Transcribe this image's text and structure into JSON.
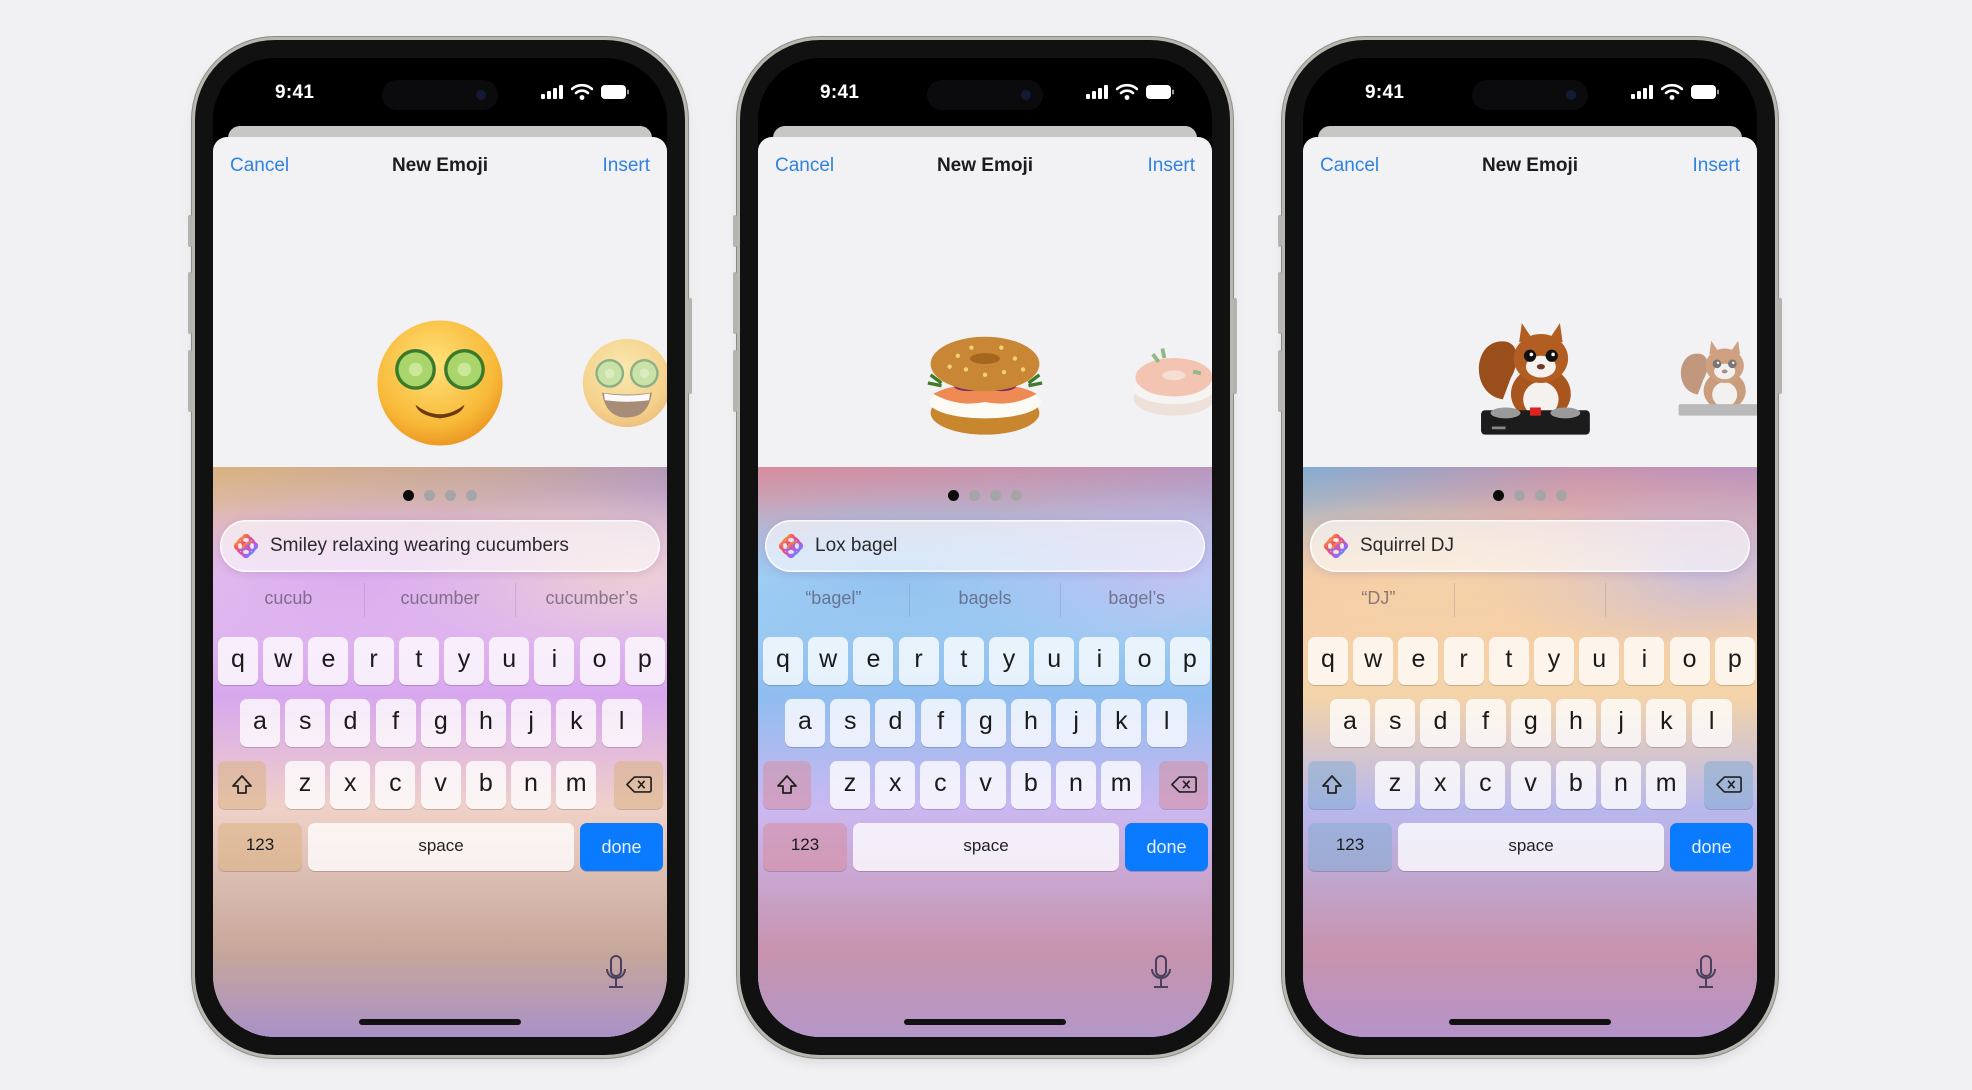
{
  "background": "#f1f1f3",
  "accent": "#2f82e0",
  "done_color": "#0a7aff",
  "phones": [
    {
      "status": {
        "time": "9:41",
        "icons": [
          "cellular-signal-icon",
          "wifi-icon",
          "battery-icon"
        ]
      },
      "nav": {
        "cancel": "Cancel",
        "title": "New Emoji",
        "insert": "Insert"
      },
      "carousel": {
        "main_image": "cucumber-face-emoji",
        "next_image": "grinning-cucumber-face-emoji",
        "pages": 4,
        "active_page": 1
      },
      "search": {
        "icon": "apple-intelligence-icon",
        "query": "Smiley relaxing wearing cucumbers"
      },
      "suggestions": [
        "cucub",
        "cucumber",
        "cucumber’s"
      ],
      "theme": {
        "glow": [
          "#e8c6ef",
          "#d7a7ee",
          "#efd1c8"
        ],
        "bottom": [
          "#d9b27f",
          "#c7a79a",
          "#a991c7"
        ]
      }
    },
    {
      "status": {
        "time": "9:41",
        "icons": [
          "cellular-signal-icon",
          "wifi-icon",
          "battery-icon"
        ]
      },
      "nav": {
        "cancel": "Cancel",
        "title": "New Emoji",
        "insert": "Insert"
      },
      "carousel": {
        "main_image": "lox-bagel-emoji",
        "next_image": "salmon-bagel-emoji",
        "pages": 4,
        "active_page": 1
      },
      "search": {
        "icon": "apple-intelligence-icon",
        "query": "Lox bagel"
      },
      "suggestions": [
        "“bagel”",
        "bagels",
        "bagel’s"
      ],
      "theme": {
        "glow": [
          "#a8d8f4",
          "#8fbdf0",
          "#cbb8f1"
        ],
        "bottom": [
          "#d78d9e",
          "#c793ad",
          "#b497c8"
        ]
      }
    },
    {
      "status": {
        "time": "9:41",
        "icons": [
          "cellular-signal-icon",
          "wifi-icon",
          "battery-icon"
        ]
      },
      "nav": {
        "cancel": "Cancel",
        "title": "New Emoji",
        "insert": "Insert"
      },
      "carousel": {
        "main_image": "squirrel-dj-emoji",
        "next_image": "squirrel-turntable-emoji",
        "pages": 4,
        "active_page": 1
      },
      "search": {
        "icon": "apple-intelligence-icon",
        "query": "Squirrel DJ"
      },
      "suggestions": [
        "“DJ”",
        "",
        ""
      ],
      "theme": {
        "glow": [
          "#f6c9a6",
          "#f4d4a8",
          "#b8b8ee"
        ],
        "bottom": [
          "#84acd2",
          "#c893ad",
          "#b593c9"
        ]
      }
    }
  ],
  "keyboard": {
    "row1": [
      "q",
      "w",
      "e",
      "r",
      "t",
      "y",
      "u",
      "i",
      "o",
      "p"
    ],
    "row2": [
      "a",
      "s",
      "d",
      "f",
      "g",
      "h",
      "j",
      "k",
      "l"
    ],
    "row3": [
      "z",
      "x",
      "c",
      "v",
      "b",
      "n",
      "m"
    ],
    "shift_icon": "shift-icon",
    "delete_icon": "delete-backward-icon",
    "numbers": "123",
    "space": "space",
    "done": "done",
    "mic_icon": "microphone-icon"
  }
}
